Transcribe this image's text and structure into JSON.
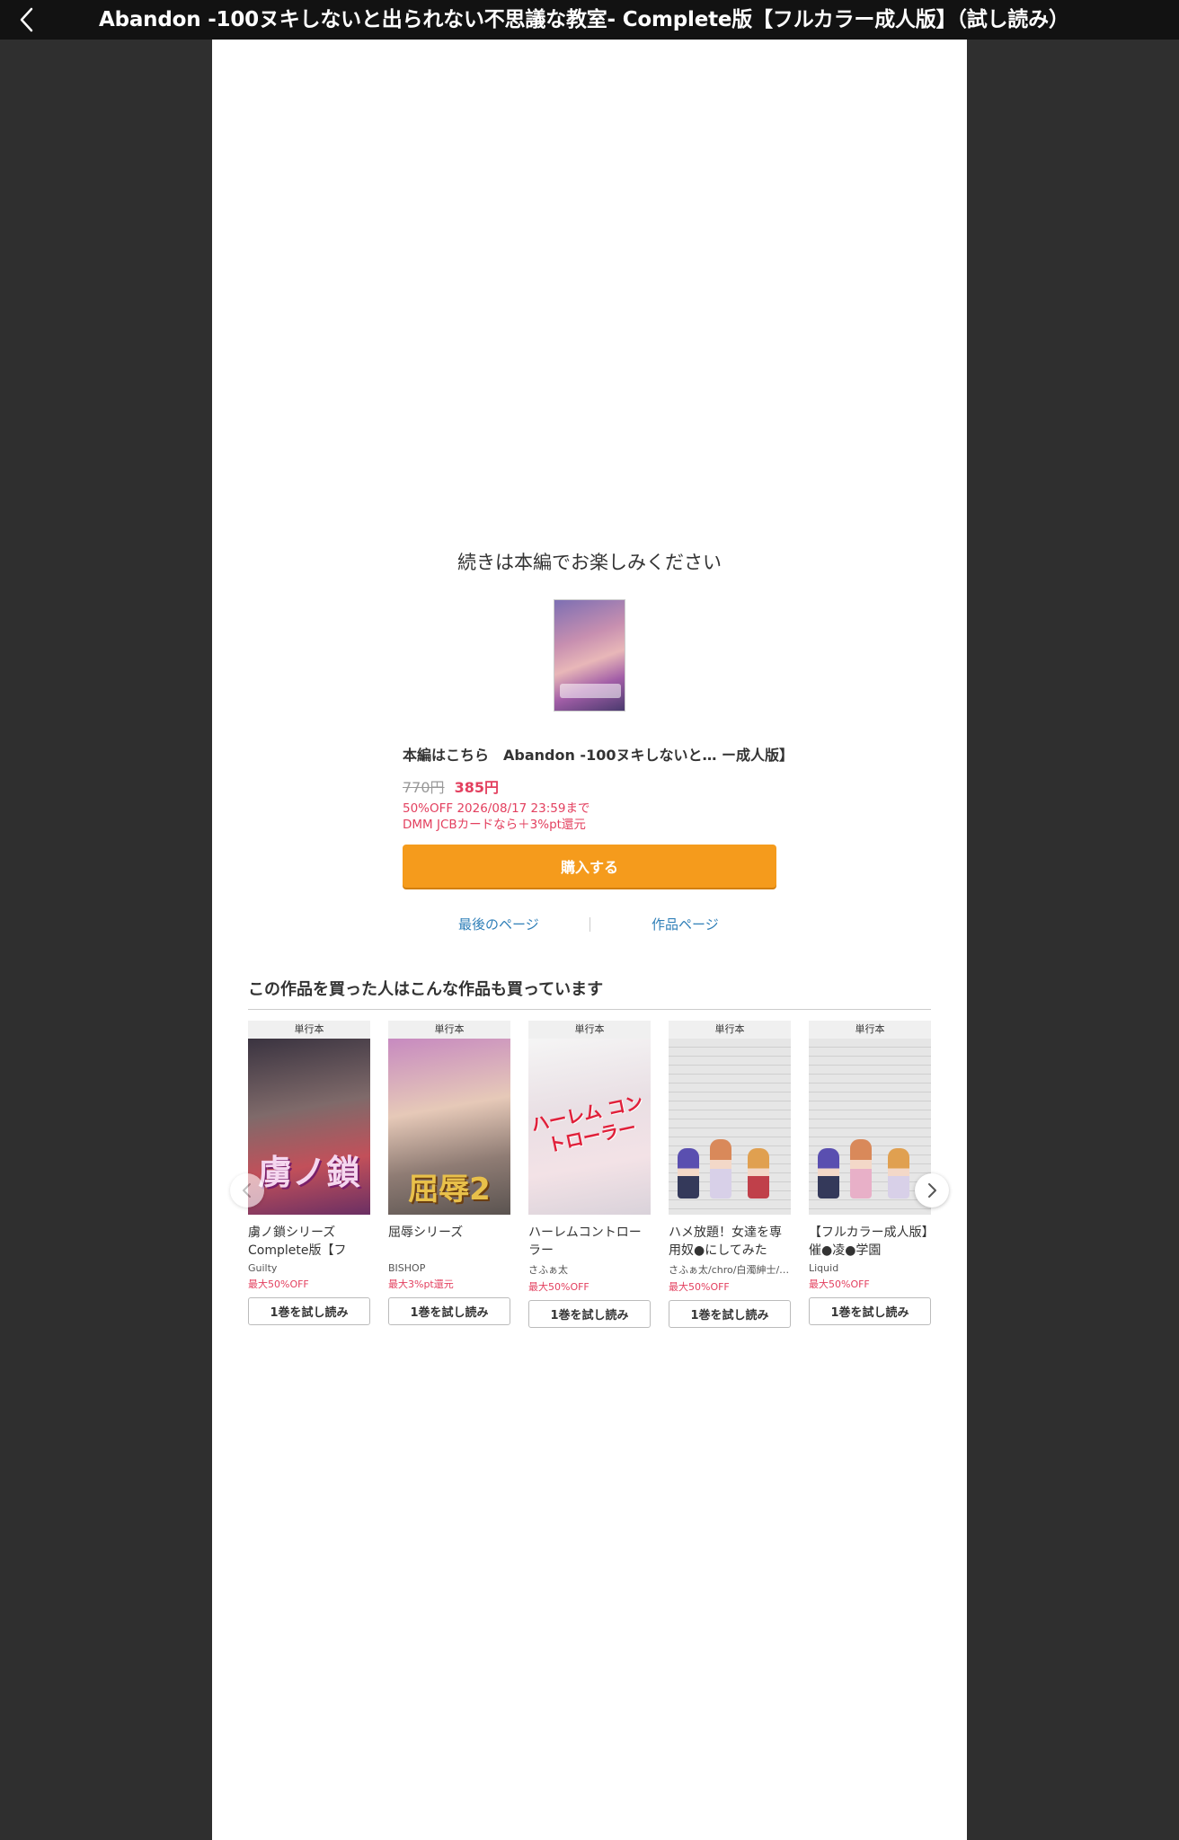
{
  "header": {
    "title": "Abandon -100ヌキしないと出られない不思議な教室- Complete版【フルカラー成人版】（試し読み）",
    "back_icon": "chevron-left-icon"
  },
  "end_screen": {
    "continue_message": "続きは本編でお楽しみください",
    "product_title": "本編はこちら　Abandon -100ヌキしないと…  ー成人版】",
    "original_price": "770円",
    "sale_price": "385円",
    "promo_line1": "50%OFF 2026/08/17 23:59まで",
    "promo_line2": "DMM JCBカードなら＋3%pt還元",
    "buy_label": "購入する",
    "last_page_link": "最後のページ",
    "work_page_link": "作品ページ"
  },
  "recommendations": {
    "title": "この作品を買った人はこんな作品も買っています",
    "prev_icon": "chevron-left-icon",
    "next_icon": "chevron-right-icon",
    "items": [
      {
        "badge": "単行本",
        "name": "虜ノ鎖シリーズ Complete版【フル…",
        "author": "Guilty",
        "discount": "最大50%OFF",
        "button": "1巻を試し読み",
        "cover_text": "虜ノ鎖"
      },
      {
        "badge": "単行本",
        "name": "屈辱シリーズ",
        "author": "BISHOP",
        "discount": "最大3%pt還元",
        "button": "1巻を試し読み",
        "cover_text": "屈辱2"
      },
      {
        "badge": "単行本",
        "name": "ハーレムコントローラー",
        "author": "さふぁ太",
        "discount": "最大50%OFF",
        "button": "1巻を試し読み",
        "cover_text": "ハーレム コントローラー"
      },
      {
        "badge": "単行本",
        "name": "ハメ放題！女達を専用奴●にしてみた",
        "author": "さふぁ太/chro/白濁紳士/…",
        "discount": "最大50%OFF",
        "button": "1巻を試し読み"
      },
      {
        "badge": "単行本",
        "name": "【フルカラー成人版】催●凌●学園",
        "author": "Liquid",
        "discount": "最大50%OFF",
        "button": "1巻を試し読み"
      }
    ]
  }
}
